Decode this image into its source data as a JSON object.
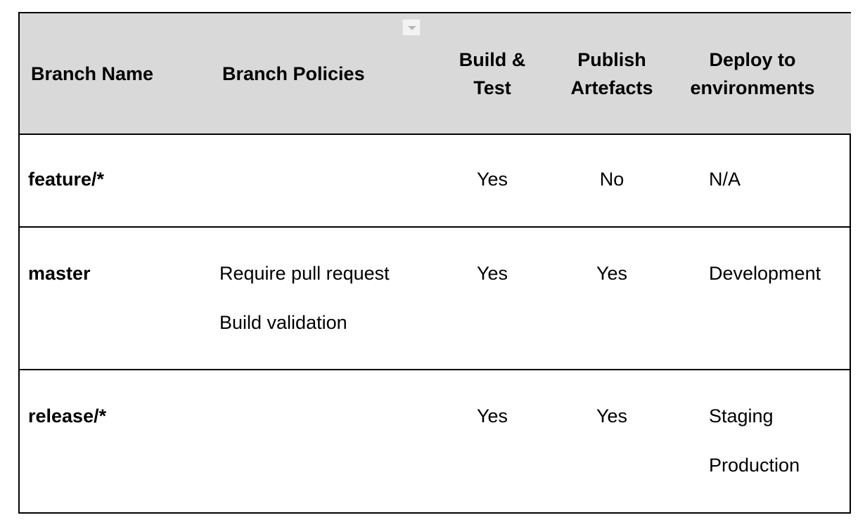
{
  "table": {
    "headers": {
      "branch_name": "Branch Name",
      "branch_policies": "Branch Policies",
      "build_test_line1": "Build &",
      "build_test_line2": "Test",
      "publish_line1": "Publish",
      "publish_line2": "Artefacts",
      "deploy_line1": "Deploy to",
      "deploy_line2": "environments"
    },
    "rows": [
      {
        "branch": "feature/*",
        "policies": [
          "",
          ""
        ],
        "build_test": "Yes",
        "publish": "No",
        "deploy": [
          "N/A",
          ""
        ]
      },
      {
        "branch": "master",
        "policies": [
          "Require pull request",
          "Build validation"
        ],
        "build_test": "Yes",
        "publish": "Yes",
        "deploy": [
          "Development",
          ""
        ]
      },
      {
        "branch": "release/*",
        "policies": [
          "",
          ""
        ],
        "build_test": "Yes",
        "publish": "Yes",
        "deploy": [
          "Staging",
          "Production"
        ]
      }
    ]
  },
  "icons": {
    "column_menu": "chevron-down-icon"
  }
}
